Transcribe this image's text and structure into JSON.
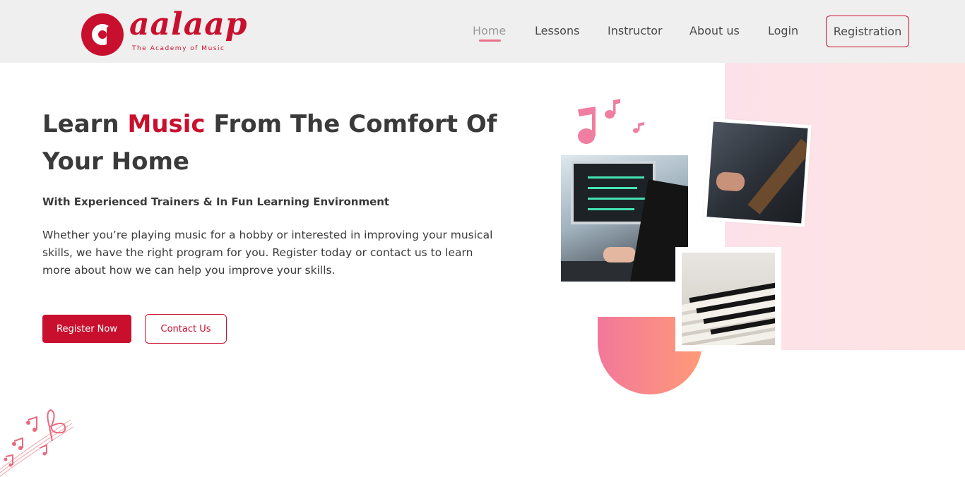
{
  "brand": {
    "name": "aalaap",
    "tagline": "The Academy of Music",
    "accent_color": "#c8102e",
    "logo_icon": "aalaap-logo-icon"
  },
  "nav": {
    "items": [
      {
        "label": "Home",
        "active": true
      },
      {
        "label": "Lessons"
      },
      {
        "label": "Instructor"
      },
      {
        "label": "About us"
      },
      {
        "label": "Login"
      }
    ],
    "register_label": "Registration"
  },
  "hero": {
    "title_part1": "Learn ",
    "title_accent": "Music",
    "title_part2": " From The Comfort Of Your Home",
    "subtitle": "With Experienced Trainers & In Fun Learning Environment",
    "description": "Whether you’re playing music for a hobby or interested in improving your musical skills, we have the right program for you. Register today or contact us to learn more about how we can help you improve your skills.",
    "primary_button": "Register Now",
    "secondary_button": "Contact Us"
  },
  "visuals": {
    "photos": [
      "studio-photo",
      "guitar-photo",
      "piano-photo"
    ],
    "decor_icons": [
      "music-notes-icon",
      "treble-clef-decor-icon"
    ],
    "panel_color": "#fde1ea",
    "gradient_colors": [
      "#f2789a",
      "#ff9a78"
    ]
  }
}
